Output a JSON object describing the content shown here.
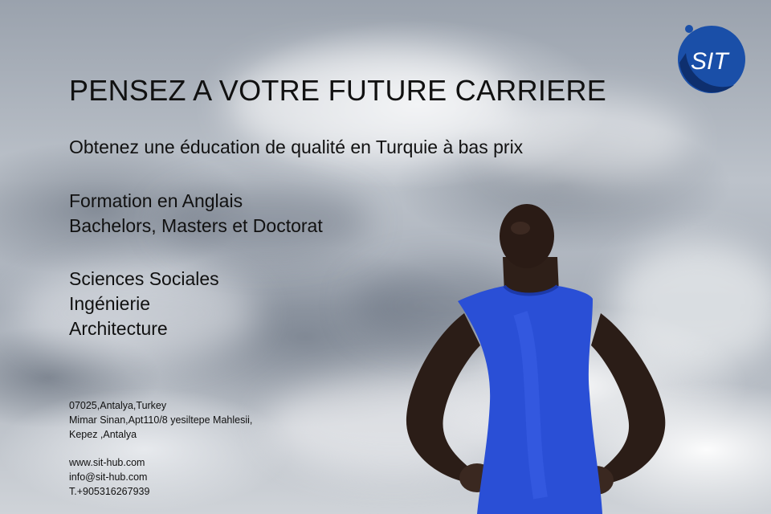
{
  "poster": {
    "headline": "PENSEZ A VOTRE FUTURE CARRIERE",
    "subtitle": "Obtenez une éducation de qualité en Turquie à bas prix",
    "programs": [
      "Formation en Anglais",
      "Bachelors, Masters et Doctorat"
    ],
    "fields": [
      "Sciences Sociales",
      "Ingénierie",
      "Architecture"
    ],
    "address": [
      "07025,Antalya,Turkey",
      "Mimar Sinan,Apt110/8 yesiltepe Mahlesii,",
      "Kepez ,Antalya"
    ],
    "contact": [
      "www.sit-hub.com",
      "info@sit-hub.com",
      "T.+905316267939"
    ],
    "logo_text": "SIT"
  },
  "colors": {
    "logo_blue": "#1a4fa8",
    "shirt_blue": "#2a4fd6",
    "text": "#111111"
  },
  "icons": {
    "logo": "sit-logo-icon",
    "photo": "athlete-photo"
  }
}
